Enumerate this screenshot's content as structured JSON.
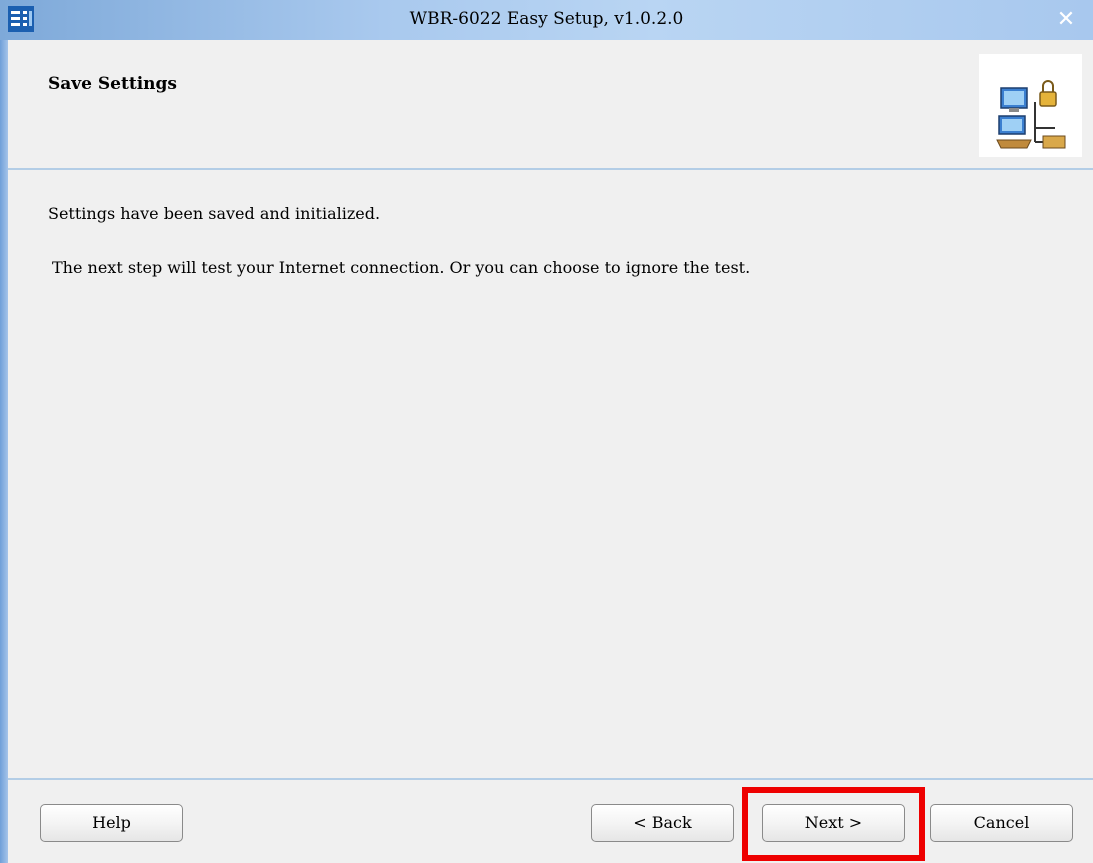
{
  "window": {
    "title": "WBR-6022 Easy Setup, v1.0.2.0",
    "app_icon": "setup-app-icon",
    "close_label": "✕"
  },
  "header": {
    "title": "Save Settings",
    "icon": "network-computers-lock-icon"
  },
  "content": {
    "line1": "Settings have been saved and initialized.",
    "line2": "The next step will test your Internet connection. Or you can choose to ignore the test."
  },
  "footer": {
    "help_label": "Help",
    "back_label": "< Back",
    "next_label": "Next >",
    "cancel_label": "Cancel"
  },
  "colors": {
    "highlight": "#ee0000",
    "titlebar": "#a9c9ee",
    "separator": "#b3cde6"
  }
}
